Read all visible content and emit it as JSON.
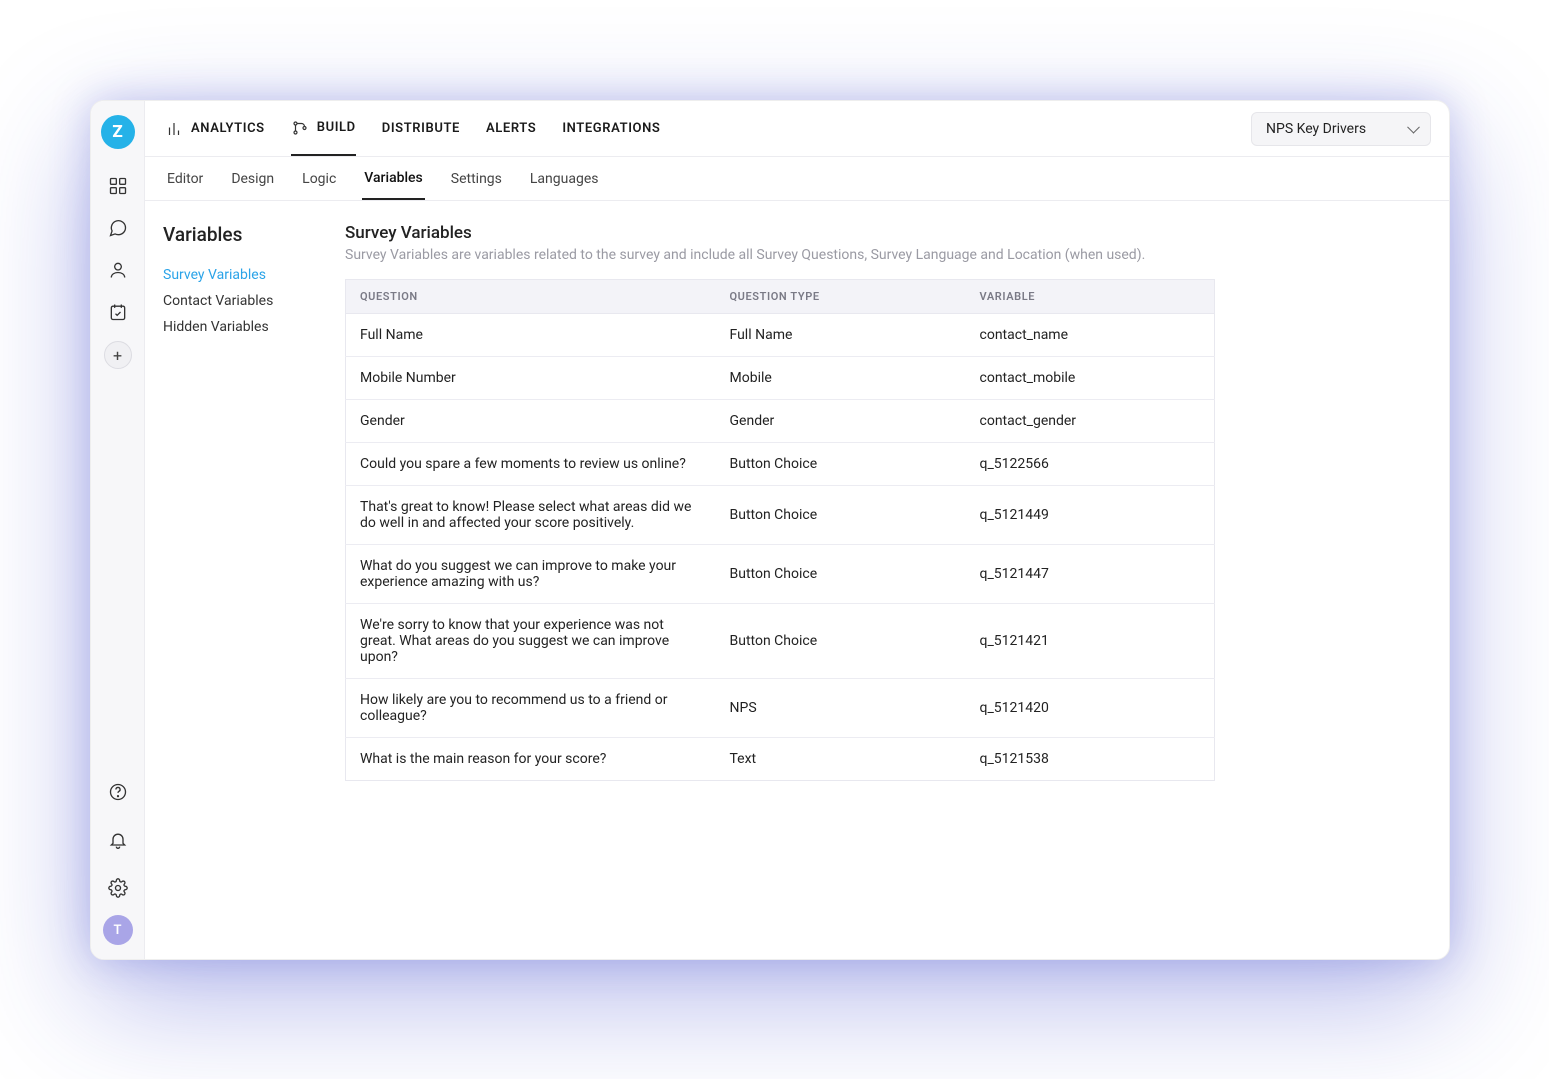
{
  "project_selector": {
    "label": "NPS Key Drivers"
  },
  "topnav": {
    "items": [
      {
        "label": "ANALYTICS"
      },
      {
        "label": "BUILD"
      },
      {
        "label": "DISTRIBUTE"
      },
      {
        "label": "ALERTS"
      },
      {
        "label": "INTEGRATIONS"
      }
    ],
    "active_index": 1
  },
  "subnav": {
    "items": [
      {
        "label": "Editor"
      },
      {
        "label": "Design"
      },
      {
        "label": "Logic"
      },
      {
        "label": "Variables"
      },
      {
        "label": "Settings"
      },
      {
        "label": "Languages"
      }
    ],
    "active_index": 3
  },
  "side_panel": {
    "title": "Variables",
    "links": [
      {
        "label": "Survey Variables"
      },
      {
        "label": "Contact Variables"
      },
      {
        "label": "Hidden Variables"
      }
    ],
    "active_index": 0
  },
  "section": {
    "title": "Survey Variables",
    "description": "Survey Variables are variables related to the survey and include all Survey Questions, Survey Language and Location (when used)."
  },
  "table": {
    "headers": {
      "question": "QUESTION",
      "type": "QUESTION TYPE",
      "variable": "VARIABLE"
    },
    "rows": [
      {
        "question": "Full Name",
        "type": "Full Name",
        "variable": "contact_name"
      },
      {
        "question": "Mobile Number",
        "type": "Mobile",
        "variable": "contact_mobile"
      },
      {
        "question": "Gender",
        "type": "Gender",
        "variable": "contact_gender"
      },
      {
        "question": "Could you spare a few moments to review us online?",
        "type": "Button Choice",
        "variable": "q_5122566"
      },
      {
        "question": "That's great to know! Please select what areas did we do well in and affected your score positively.",
        "type": "Button Choice",
        "variable": "q_5121449"
      },
      {
        "question": "What do you suggest we can improve to make your experience amazing with us?",
        "type": "Button Choice",
        "variable": "q_5121447"
      },
      {
        "question": "We're sorry to know that your experience was not great. What areas do you suggest we can improve upon?",
        "type": "Button Choice",
        "variable": "q_5121421"
      },
      {
        "question": "How likely are you to recommend us to a friend or colleague?",
        "type": "NPS",
        "variable": "q_5121420"
      },
      {
        "question": "What is the main reason for your score?",
        "type": "Text",
        "variable": "q_5121538"
      }
    ]
  },
  "avatar_initial": "T"
}
